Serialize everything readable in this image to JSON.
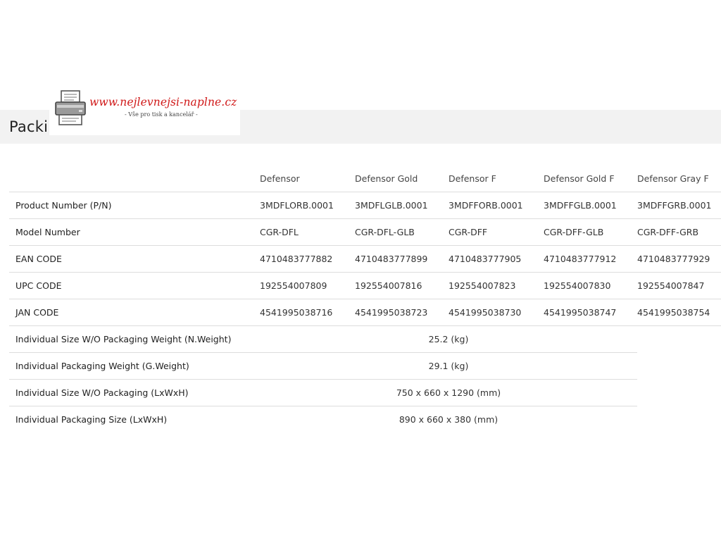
{
  "page": {
    "section_title": "Packing"
  },
  "watermark": {
    "url": "www.nejlevnejsi-naplne.cz",
    "tagline": "- Vše pro tisk a kancelář -",
    "icon": "printer-icon",
    "url_color": "#d01818"
  },
  "table": {
    "columns": [
      "Defensor",
      "Defensor Gold",
      "Defensor F",
      "Defensor Gold F",
      "Defensor Gray F"
    ],
    "rows": [
      {
        "label": "Product Number (P/N)",
        "values": [
          "3MDFLORB.0001",
          "3MDFLGLB.0001",
          "3MDFFORB.0001",
          "3MDFFGLB.0001",
          "3MDFFGRB.0001"
        ]
      },
      {
        "label": "Model Number",
        "values": [
          "CGR-DFL",
          "CGR-DFL-GLB",
          "CGR-DFF",
          "CGR-DFF-GLB",
          "CGR-DFF-GRB"
        ]
      },
      {
        "label": "EAN CODE",
        "values": [
          "4710483777882",
          "4710483777899",
          "4710483777905",
          "4710483777912",
          "4710483777929"
        ]
      },
      {
        "label": "UPC CODE",
        "values": [
          "192554007809",
          "192554007816",
          "192554007823",
          "192554007830",
          "192554007847"
        ]
      },
      {
        "label": "JAN CODE",
        "values": [
          "4541995038716",
          "4541995038723",
          "4541995038730",
          "4541995038747",
          "4541995038754"
        ]
      }
    ],
    "merged_rows": [
      {
        "label": "Individual Size W/O Packaging Weight (N.Weight)",
        "value": "25.2 (kg)"
      },
      {
        "label": "Individual Packaging Weight (G.Weight)",
        "value": "29.1 (kg)"
      },
      {
        "label": "Individual Size W/O Packaging (LxWxH)",
        "value": "750 x 660 x 1290 (mm)"
      },
      {
        "label": "Individual Packaging Size (LxWxH)",
        "value": "890 x 660 x 380 (mm)"
      }
    ]
  }
}
